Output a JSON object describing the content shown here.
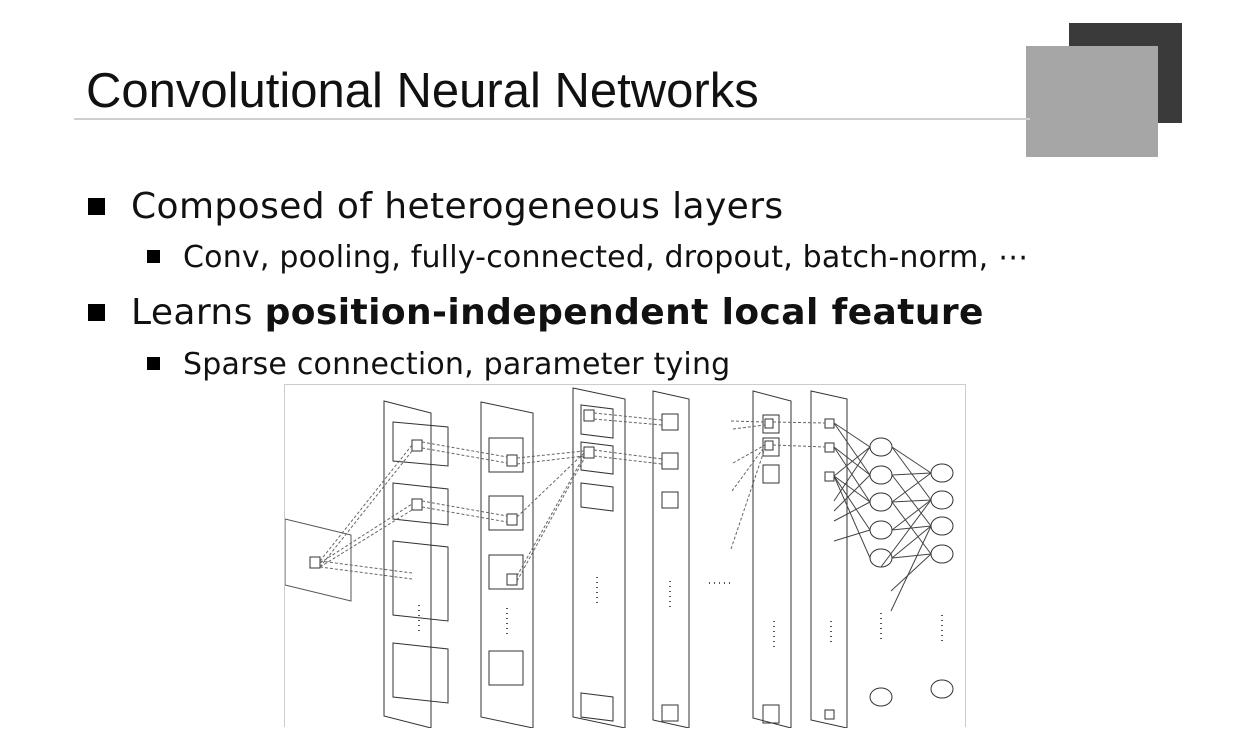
{
  "slide": {
    "title": "Convolutional Neural Networks",
    "bullets": [
      {
        "text": "Composed of heterogeneous layers",
        "sub": "Conv, pooling, fully-connected, dropout, batch-norm, ⋯"
      },
      {
        "text_plain": "Learns ",
        "text_bold": "position-independent local feature",
        "sub": "Sparse connection, parameter tying"
      }
    ]
  },
  "colors": {
    "deco_dark": "#3a3a3a",
    "deco_light": "#a6a6a6",
    "rule": "#cfcfcf"
  }
}
